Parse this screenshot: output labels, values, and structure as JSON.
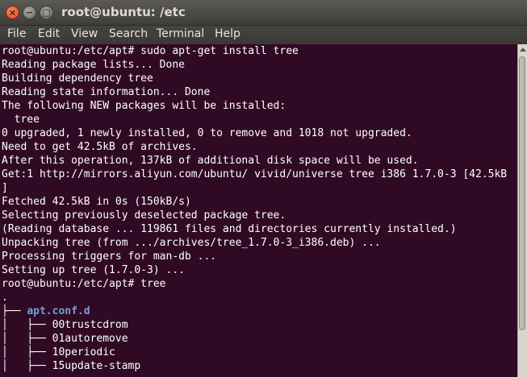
{
  "window": {
    "title": "root@ubuntu: /etc",
    "close_glyph": "×",
    "min_glyph": "−",
    "max_glyph": "□"
  },
  "menu": [
    "File",
    "Edit",
    "View",
    "Search",
    "Terminal",
    "Help"
  ],
  "terminal": {
    "lines": [
      "root@ubuntu:/etc/apt# sudo apt-get install tree",
      "Reading package lists... Done",
      "Building dependency tree",
      "Reading state information... Done",
      "The following NEW packages will be installed:",
      "  tree",
      "0 upgraded, 1 newly installed, 0 to remove and 1018 not upgraded.",
      "Need to get 42.5kB of archives.",
      "After this operation, 137kB of additional disk space will be used.",
      "Get:1 http://mirrors.aliyun.com/ubuntu/ vivid/universe tree i386 1.7.0-3 [42.5kB",
      "]",
      "Fetched 42.5kB in 0s (150kB/s)",
      "Selecting previously deselected package tree.",
      "(Reading database ... 119861 files and directories currently installed.)",
      "Unpacking tree (from .../archives/tree_1.7.0-3_i386.deb) ...",
      "Processing triggers for man-db ...",
      "Setting up tree (1.7.0-3) ...",
      "root@ubuntu:/etc/apt# tree",
      "."
    ],
    "tree_dir": {
      "prefix": "├── ",
      "name": "apt.conf.d"
    },
    "tree_items": [
      "│   ├── 00trustcdrom",
      "│   ├── 01autoremove",
      "│   ├── 10periodic",
      "│   ├── 15update-stamp"
    ]
  },
  "colors": {
    "terminal_bg": "#300a24",
    "terminal_fg": "#ffffff",
    "directory": "#729fcf",
    "close_button": "#e9541f"
  }
}
